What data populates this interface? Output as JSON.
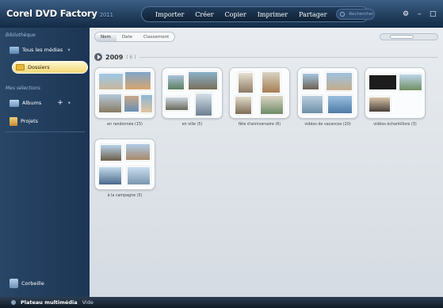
{
  "app": {
    "title": "Corel DVD Factory",
    "title_suffix": "2011"
  },
  "menu": {
    "items": [
      "Importer",
      "Créer",
      "Copier",
      "Imprimer",
      "Partager"
    ],
    "search_placeholder": "Rechercher"
  },
  "window_controls": [
    "⚙",
    "–",
    "□"
  ],
  "sidebar": {
    "library_label": "Bibliothèque",
    "all_media": "Tous les médias",
    "folders": "Dossiers",
    "selections_label": "Mes sélections",
    "albums": "Albums",
    "projects": "Projets",
    "trash": "Corbeille"
  },
  "sort_tabs": {
    "items": [
      "Nom",
      "Date",
      "Classement"
    ],
    "active": 0
  },
  "group": {
    "year": "2009",
    "count": "( 6 )"
  },
  "albums": [
    {
      "label": "en randonnée (15)"
    },
    {
      "label": "en ville (5)"
    },
    {
      "label": "fête d'anniversaire (6)"
    },
    {
      "label": "vidéos de vacances (20)"
    },
    {
      "label": "vidéos échantillons (3)"
    },
    {
      "label": "à la campagne (5)"
    }
  ],
  "status": {
    "label": "Plateau multimédia",
    "value": "Vide"
  },
  "colors": {
    "titlebar": "#23405f",
    "sidebar": "#294667",
    "folder_highlight": "#f2d873",
    "content": "#e8ecf0"
  }
}
